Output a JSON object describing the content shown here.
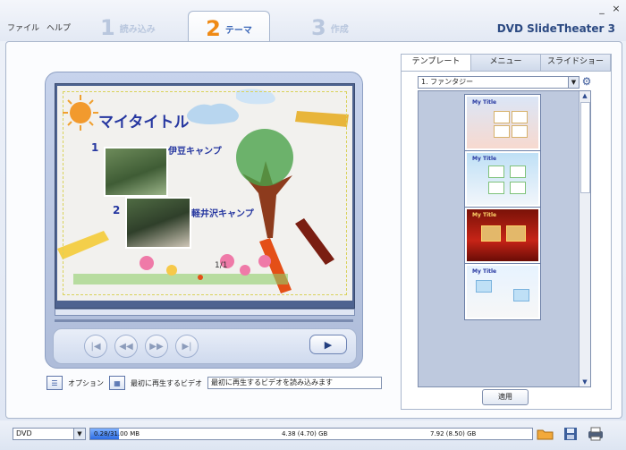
{
  "app": {
    "brand": "DVD SlideTheater 3",
    "menu": [
      "ファイル",
      "ヘルプ"
    ],
    "window_buttons": [
      "_",
      "×"
    ]
  },
  "steps": [
    {
      "num": "1",
      "label": "読み込み",
      "active": false
    },
    {
      "num": "2",
      "label": "テーマ",
      "active": true
    },
    {
      "num": "3",
      "label": "作成",
      "active": false
    }
  ],
  "preview": {
    "title": "マイタイトル",
    "chapters": [
      {
        "num": "1",
        "label": "伊豆キャンプ"
      },
      {
        "num": "2",
        "label": "軽井沢キャンプ"
      }
    ],
    "page": "1/1"
  },
  "player": {
    "buttons": [
      "|◀",
      "◀◀",
      "▶▶",
      "▶|"
    ],
    "play": "▶"
  },
  "options": {
    "option_label": "オプション",
    "firstplay_label": "最初に再生するビデオ",
    "firstplay_value": "最初に再生するビデオを読み込みます"
  },
  "right_panel": {
    "tabs": [
      "テンプレート",
      "メニュー",
      "スライドショー"
    ],
    "selected_template": "1. ファンタジー",
    "templates": [
      {
        "title": "My Title"
      },
      {
        "title": "My Title"
      },
      {
        "title": "My Title"
      },
      {
        "title": "My Title"
      }
    ],
    "apply": "適用"
  },
  "bottom": {
    "disc_type": "DVD",
    "capacity": {
      "used_fraction": 0.065,
      "labels": [
        "0.28/31.00 MB",
        "4.38 (4.70) GB",
        "7.92 (8.50) GB"
      ]
    },
    "icons": [
      "folder-open-icon",
      "save-icon",
      "print-icon"
    ]
  },
  "colors": {
    "accent": "#ef8a15",
    "title_blue": "#2637a0",
    "panel_border": "#a9b6cc"
  }
}
